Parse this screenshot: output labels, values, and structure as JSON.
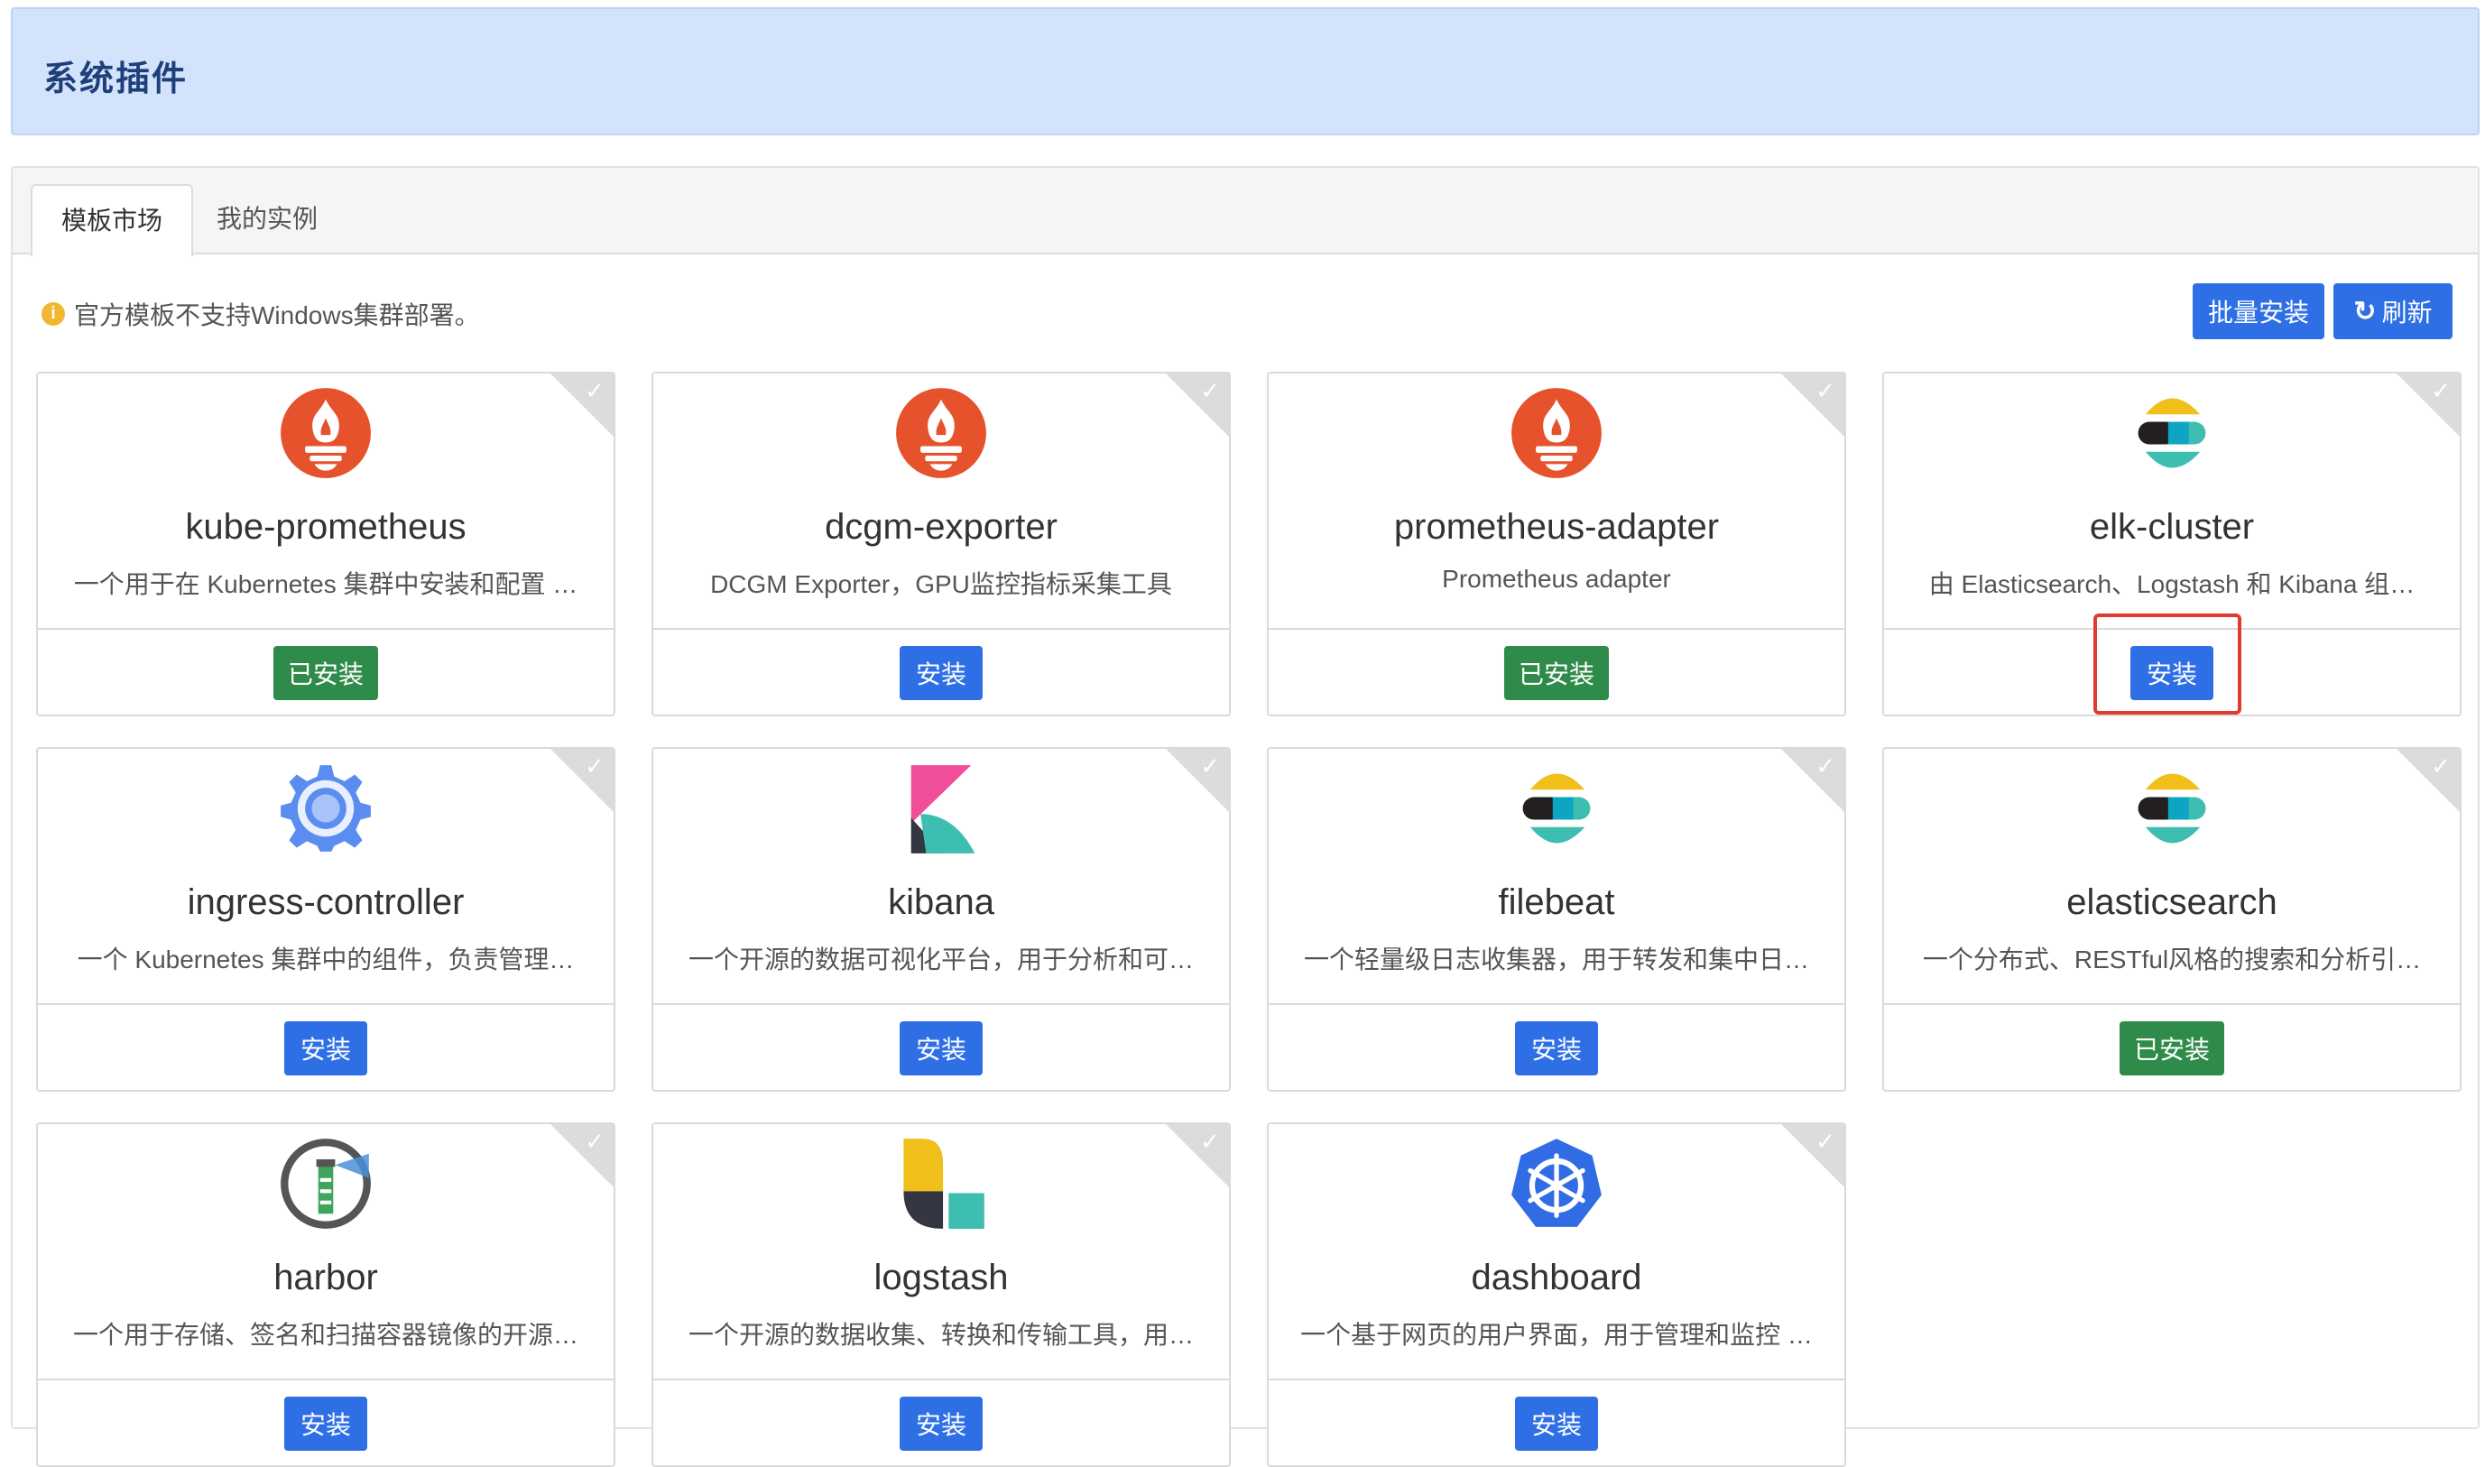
{
  "header": {
    "title": "系统插件"
  },
  "tabs": [
    {
      "label": "模板市场",
      "active": true
    },
    {
      "label": "我的实例",
      "active": false
    }
  ],
  "notice": {
    "icon": "info-icon",
    "text": "官方模板不支持Windows集群部署。"
  },
  "toolbar": {
    "batch_install": "批量安装",
    "refresh": "刷新"
  },
  "colors": {
    "primary": "#2e6fe6",
    "installed": "#2f8b4a",
    "header_bg": "#d3e3fc",
    "highlight": "#e33a2f"
  },
  "cards": [
    {
      "name": "kube-prometheus",
      "desc": "一个用于在 Kubernetes 集群中安装和配置 …",
      "button": "已安装",
      "status": "installed",
      "icon": "prometheus-icon"
    },
    {
      "name": "dcgm-exporter",
      "desc": "DCGM Exporter，GPU监控指标采集工具",
      "button": "安装",
      "status": "install",
      "icon": "prometheus-icon"
    },
    {
      "name": "prometheus-adapter",
      "desc": "Prometheus adapter",
      "button": "已安装",
      "status": "installed",
      "icon": "prometheus-icon"
    },
    {
      "name": "elk-cluster",
      "desc": "由 Elasticsearch、Logstash 和 Kibana 组…",
      "button": "安装",
      "status": "install",
      "icon": "elastic-icon"
    },
    {
      "name": "ingress-controller",
      "desc": "一个 Kubernetes 集群中的组件，负责管理…",
      "button": "安装",
      "status": "install",
      "icon": "gear-icon"
    },
    {
      "name": "kibana",
      "desc": "一个开源的数据可视化平台，用于分析和可…",
      "button": "安装",
      "status": "install",
      "icon": "kibana-icon"
    },
    {
      "name": "filebeat",
      "desc": "一个轻量级日志收集器，用于转发和集中日…",
      "button": "安装",
      "status": "install",
      "icon": "elastic-icon"
    },
    {
      "name": "elasticsearch",
      "desc": "一个分布式、RESTful风格的搜索和分析引…",
      "button": "已安装",
      "status": "installed",
      "icon": "elastic-icon"
    },
    {
      "name": "harbor",
      "desc": "一个用于存储、签名和扫描容器镜像的开源…",
      "button": "安装",
      "status": "install",
      "icon": "harbor-icon"
    },
    {
      "name": "logstash",
      "desc": "一个开源的数据收集、转换和传输工具，用…",
      "button": "安装",
      "status": "install",
      "icon": "logstash-icon"
    },
    {
      "name": "dashboard",
      "desc": "一个基于网页的用户界面，用于管理和监控 …",
      "button": "安装",
      "status": "install",
      "icon": "kubernetes-icon"
    }
  ]
}
